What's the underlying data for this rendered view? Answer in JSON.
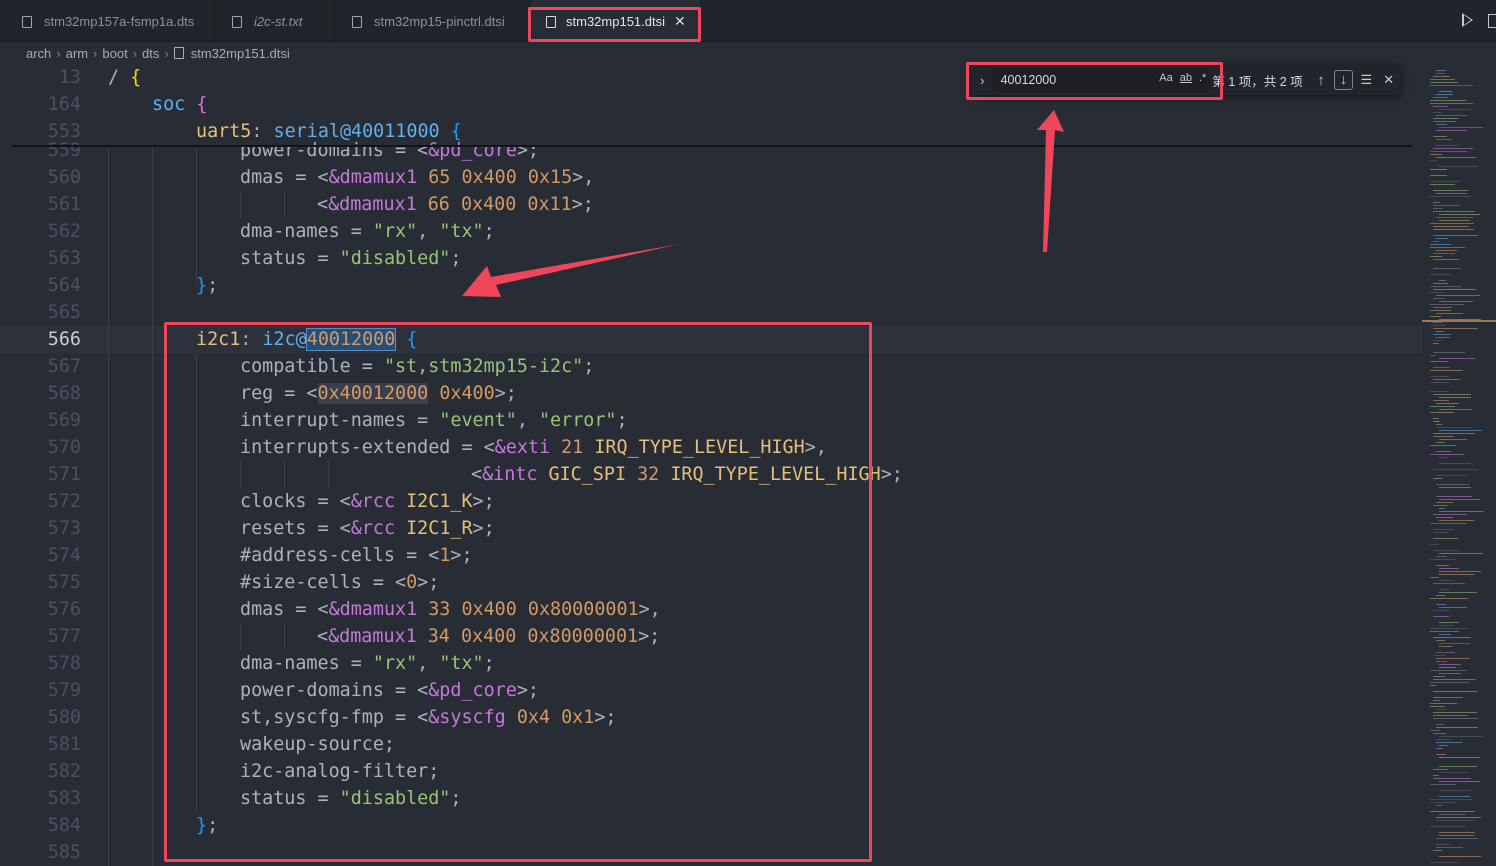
{
  "tabs": [
    {
      "label": "stm32mp157a-fsmp1a.dts",
      "active": false,
      "italic": false
    },
    {
      "label": "i2c-st.txt",
      "active": false,
      "italic": true
    },
    {
      "label": "stm32mp15-pinctrl.dtsi",
      "active": false,
      "italic": false
    },
    {
      "label": "stm32mp151.dtsi",
      "active": true,
      "italic": false
    }
  ],
  "tab_close_glyph": "✕",
  "breadcrumb": [
    "arch",
    "arm",
    "boot",
    "dts",
    "stm32mp151.dtsi"
  ],
  "breadcrumb_sep": "›",
  "find": {
    "query": "40012000",
    "match_case_label": "Aa",
    "whole_word_label": "ab",
    "regex_label": ".*",
    "count": "第 1 项，共 2 项",
    "toggle_glyph": "›",
    "prev_glyph": "↑",
    "next_glyph": "↓",
    "selection_glyph": "☰",
    "close_glyph": "✕"
  },
  "sticky_lines": [
    {
      "num": "13",
      "indent": 0,
      "tokens": [
        [
          "/ ",
          "plain"
        ],
        [
          "{",
          "brace0"
        ]
      ]
    },
    {
      "num": "164",
      "indent": 1,
      "tokens": [
        [
          "soc ",
          "label"
        ],
        [
          "{",
          "brace1"
        ]
      ]
    },
    {
      "num": "553",
      "indent": 2,
      "tokens": [
        [
          "uart5",
          "node"
        ],
        [
          ": ",
          "plain"
        ],
        [
          "serial@40011000 ",
          "label"
        ],
        [
          "{",
          "brace2"
        ]
      ]
    }
  ],
  "lines": [
    {
      "num": "559",
      "indent": 3,
      "tokens": [
        [
          "power-domains = <",
          "plain"
        ],
        [
          "&pd_core",
          "ref"
        ],
        [
          ">;",
          "plain"
        ]
      ]
    },
    {
      "num": "560",
      "indent": 3,
      "tokens": [
        [
          "dmas = <",
          "plain"
        ],
        [
          "&dmamux1 ",
          "ref"
        ],
        [
          "65 0x400 0x15",
          "num"
        ],
        [
          ">,",
          "plain"
        ]
      ]
    },
    {
      "num": "561",
      "indent": 3,
      "tokens": [
        [
          "\t",
          "plain"
        ],
        [
          "<",
          "plain"
        ],
        [
          "&dmamux1 ",
          "ref"
        ],
        [
          "66 0x400 0x11",
          "num"
        ],
        [
          ">;",
          "plain"
        ]
      ]
    },
    {
      "num": "562",
      "indent": 3,
      "tokens": [
        [
          "dma-names = ",
          "plain"
        ],
        [
          "\"rx\"",
          "str"
        ],
        [
          ", ",
          "plain"
        ],
        [
          "\"tx\"",
          "str"
        ],
        [
          ";",
          "plain"
        ]
      ]
    },
    {
      "num": "563",
      "indent": 3,
      "tokens": [
        [
          "status = ",
          "plain"
        ],
        [
          "\"disabled\"",
          "str"
        ],
        [
          ";",
          "plain"
        ]
      ]
    },
    {
      "num": "564",
      "indent": 2,
      "tokens": [
        [
          "}",
          "brace2"
        ],
        [
          ";",
          "plain"
        ]
      ]
    },
    {
      "num": "565",
      "indent": 0,
      "tokens": []
    },
    {
      "num": "566",
      "indent": 2,
      "current": true,
      "tokens": [
        [
          "i2c1",
          "node"
        ],
        [
          ": ",
          "plain"
        ],
        [
          "i2c@",
          "label"
        ],
        [
          "40012000",
          "match-main"
        ],
        [
          " ",
          "plain"
        ],
        [
          "{",
          "brace2"
        ]
      ]
    },
    {
      "num": "567",
      "indent": 3,
      "tokens": [
        [
          "compatible = ",
          "plain"
        ],
        [
          "\"st,stm32mp15-i2c\"",
          "str"
        ],
        [
          ";",
          "plain"
        ]
      ]
    },
    {
      "num": "568",
      "indent": 3,
      "tokens": [
        [
          "reg = <",
          "plain"
        ],
        [
          "0x40012000",
          "match-other-num"
        ],
        [
          " 0x400",
          "num"
        ],
        [
          ">;",
          "plain"
        ]
      ]
    },
    {
      "num": "569",
      "indent": 3,
      "tokens": [
        [
          "interrupt-names = ",
          "plain"
        ],
        [
          "\"event\"",
          "str"
        ],
        [
          ", ",
          "plain"
        ],
        [
          "\"error\"",
          "str"
        ],
        [
          ";",
          "plain"
        ]
      ]
    },
    {
      "num": "570",
      "indent": 3,
      "tokens": [
        [
          "interrupts-extended = <",
          "plain"
        ],
        [
          "&exti ",
          "ref"
        ],
        [
          "21 ",
          "num"
        ],
        [
          "IRQ_TYPE_LEVEL_HIGH",
          "node"
        ],
        [
          ">,",
          "plain"
        ]
      ]
    },
    {
      "num": "571",
      "indent": 3,
      "tokens": [
        [
          "\t\t\t",
          "plain"
        ],
        [
          "<",
          "plain"
        ],
        [
          "&intc ",
          "ref"
        ],
        [
          "GIC_SPI ",
          "node"
        ],
        [
          "32 ",
          "num"
        ],
        [
          "IRQ_TYPE_LEVEL_HIGH",
          "node"
        ],
        [
          ">;",
          "plain"
        ]
      ]
    },
    {
      "num": "572",
      "indent": 3,
      "tokens": [
        [
          "clocks = <",
          "plain"
        ],
        [
          "&rcc ",
          "ref"
        ],
        [
          "I2C1_K",
          "node"
        ],
        [
          ">;",
          "plain"
        ]
      ]
    },
    {
      "num": "573",
      "indent": 3,
      "tokens": [
        [
          "resets = <",
          "plain"
        ],
        [
          "&rcc ",
          "ref"
        ],
        [
          "I2C1_R",
          "node"
        ],
        [
          ">;",
          "plain"
        ]
      ]
    },
    {
      "num": "574",
      "indent": 3,
      "tokens": [
        [
          "#address-cells = <",
          "plain"
        ],
        [
          "1",
          "num"
        ],
        [
          ">;",
          "plain"
        ]
      ]
    },
    {
      "num": "575",
      "indent": 3,
      "tokens": [
        [
          "#size-cells = <",
          "plain"
        ],
        [
          "0",
          "num"
        ],
        [
          ">;",
          "plain"
        ]
      ]
    },
    {
      "num": "576",
      "indent": 3,
      "tokens": [
        [
          "dmas = <",
          "plain"
        ],
        [
          "&dmamux1 ",
          "ref"
        ],
        [
          "33 0x400 0x80000001",
          "num"
        ],
        [
          ">,",
          "plain"
        ]
      ]
    },
    {
      "num": "577",
      "indent": 3,
      "tokens": [
        [
          "\t",
          "plain"
        ],
        [
          "<",
          "plain"
        ],
        [
          "&dmamux1 ",
          "ref"
        ],
        [
          "34 0x400 0x80000001",
          "num"
        ],
        [
          ">;",
          "plain"
        ]
      ]
    },
    {
      "num": "578",
      "indent": 3,
      "tokens": [
        [
          "dma-names = ",
          "plain"
        ],
        [
          "\"rx\"",
          "str"
        ],
        [
          ", ",
          "plain"
        ],
        [
          "\"tx\"",
          "str"
        ],
        [
          ";",
          "plain"
        ]
      ]
    },
    {
      "num": "579",
      "indent": 3,
      "tokens": [
        [
          "power-domains = <",
          "plain"
        ],
        [
          "&pd_core",
          "ref"
        ],
        [
          ">;",
          "plain"
        ]
      ]
    },
    {
      "num": "580",
      "indent": 3,
      "tokens": [
        [
          "st,syscfg-fmp = <",
          "plain"
        ],
        [
          "&syscfg ",
          "ref"
        ],
        [
          "0x4 0x1",
          "num"
        ],
        [
          ">;",
          "plain"
        ]
      ]
    },
    {
      "num": "581",
      "indent": 3,
      "tokens": [
        [
          "wakeup-source;",
          "plain"
        ]
      ]
    },
    {
      "num": "582",
      "indent": 3,
      "tokens": [
        [
          "i2c-analog-filter;",
          "plain"
        ]
      ]
    },
    {
      "num": "583",
      "indent": 3,
      "tokens": [
        [
          "status = ",
          "plain"
        ],
        [
          "\"disabled\"",
          "str"
        ],
        [
          ";",
          "plain"
        ]
      ]
    },
    {
      "num": "584",
      "indent": 2,
      "tokens": [
        [
          "}",
          "brace2"
        ],
        [
          ";",
          "plain"
        ]
      ]
    },
    {
      "num": "585",
      "indent": 0,
      "tokens": []
    }
  ],
  "colors": {
    "annotation_red": "#f0465b",
    "editor_bg": "#282c34",
    "tab_bg": "#21252b",
    "match_highlight": "#264f78"
  }
}
